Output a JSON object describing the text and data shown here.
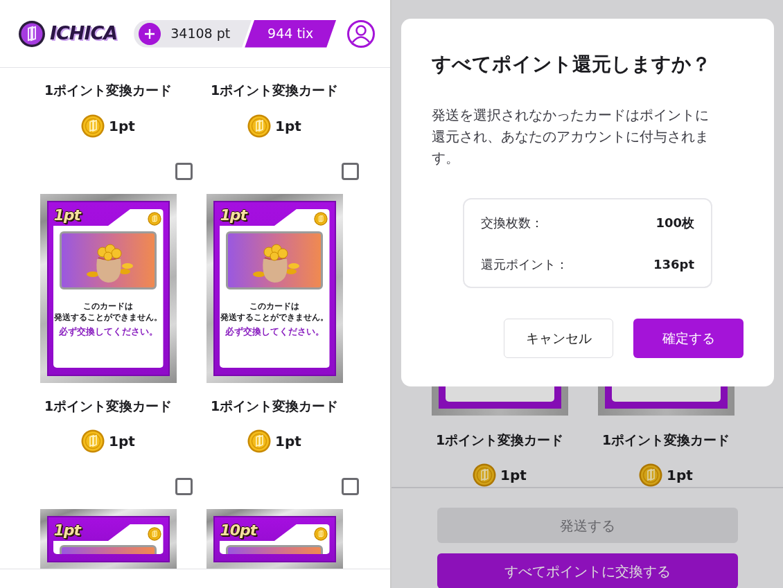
{
  "left_screen": {
    "header": {
      "logo": "ICHICA",
      "points": "34108 pt",
      "tickets": "944 tix"
    },
    "cards": [
      {
        "kind": "name_only",
        "name": "1ポイント変換カード",
        "price": "1pt"
      },
      {
        "kind": "name_only",
        "name": "1ポイント変換カード",
        "price": "1pt"
      },
      {
        "kind": "full",
        "checked": false,
        "label": "1pt",
        "lines": [
          "このカードは",
          "発送することができません。"
        ],
        "notice": "必ず交換してください。",
        "name": "1ポイント変換カード",
        "price": "1pt"
      },
      {
        "kind": "full",
        "checked": false,
        "label": "1pt",
        "lines": [
          "このカードは",
          "発送することができません。"
        ],
        "notice": "必ず交換してください。",
        "name": "1ポイント変換カード",
        "price": "1pt"
      },
      {
        "kind": "top_only",
        "checked": false,
        "label": "1pt"
      },
      {
        "kind": "top_only",
        "checked": false,
        "label": "10pt"
      }
    ]
  },
  "right_screen": {
    "cards": [
      {
        "kind": "bottom_only",
        "name": "1ポイント変換カード",
        "price": "1pt"
      },
      {
        "kind": "bottom_only",
        "name": "1ポイント変換カード",
        "price": "1pt"
      }
    ],
    "footer": {
      "buttons": [
        {
          "label": "発送する",
          "disabled": true
        },
        {
          "label": "すべてポイントに交換する",
          "disabled": false
        }
      ]
    },
    "dialog": {
      "title": "すべてポイント還元しますか？",
      "message": "発送を選択されなかったカードはポイントに還元され、あなたのアカウントに付与されます。",
      "summary": [
        {
          "label": "交換枚数：",
          "value": "100枚"
        },
        {
          "label": "還元ポイント：",
          "value": "136pt"
        }
      ],
      "cancel": "キャンセル",
      "confirm": "確定する"
    }
  }
}
